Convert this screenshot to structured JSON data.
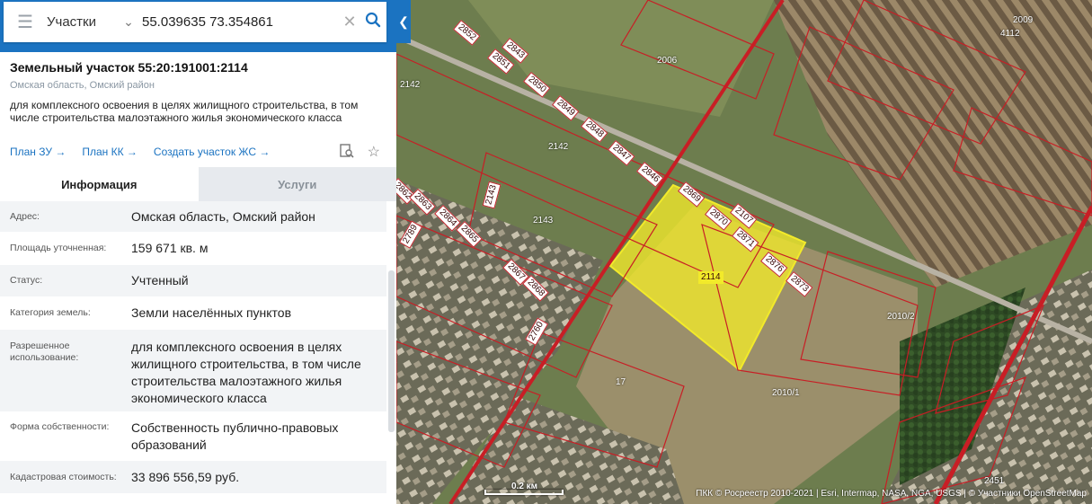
{
  "search": {
    "type_label": "Участки",
    "value": "55.039635 73.354861"
  },
  "panel": {
    "title": "Земельный участок 55:20:191001:2114",
    "region": "Омская область, Омский район",
    "purpose": "для комплексного освоения в целях жилищного строительства, в том числе строительства малоэтажного жилья экономического класса",
    "links": [
      "План ЗУ →",
      "План КК →",
      "Создать участок ЖС →"
    ],
    "tabs": [
      {
        "label": "Информация",
        "active": true
      },
      {
        "label": "Услуги",
        "active": false
      }
    ],
    "rows": [
      {
        "label": "Адрес:",
        "value": "Омская область, Омский район"
      },
      {
        "label": "Площадь уточненная:",
        "value": "159 671 кв. м"
      },
      {
        "label": "Статус:",
        "value": "Учтенный"
      },
      {
        "label": "Категория земель:",
        "value": "Земли населённых пунктов"
      },
      {
        "label": "Разрешенное использование:",
        "value": "для комплексного освоения в целях жилищного строительства, в том числе строительства малоэтажного жилья экономического класса"
      },
      {
        "label": "Форма собственности:",
        "value": "Собственность публично-правовых образований"
      },
      {
        "label": "Кадастровая стоимость:",
        "value": "33 896 556,59 руб."
      }
    ]
  },
  "map": {
    "scale_label": "0.2 км",
    "attribution": "ПКК © Росреестр 2010-2021 | Esri, Intermap, NASA, NGA, USGS | © Участники OpenStreetMap",
    "parcels": [
      "2006",
      "2009",
      "4112",
      "2142",
      "2142",
      "2143",
      "2143",
      "2114",
      "2010/2",
      "2010/1",
      "17",
      "2451",
      "2852",
      "2843",
      "2851",
      "2850",
      "2849",
      "2848",
      "2847",
      "2846",
      "2869",
      "2870",
      "2107",
      "2871",
      "2876",
      "2873",
      "2862",
      "2863",
      "2864",
      "2865",
      "2789",
      "2867",
      "2868",
      "2760"
    ],
    "colors": {
      "highlight": "#f2ea2a",
      "border": "#c81e25",
      "accent": "#1b73c1"
    }
  }
}
